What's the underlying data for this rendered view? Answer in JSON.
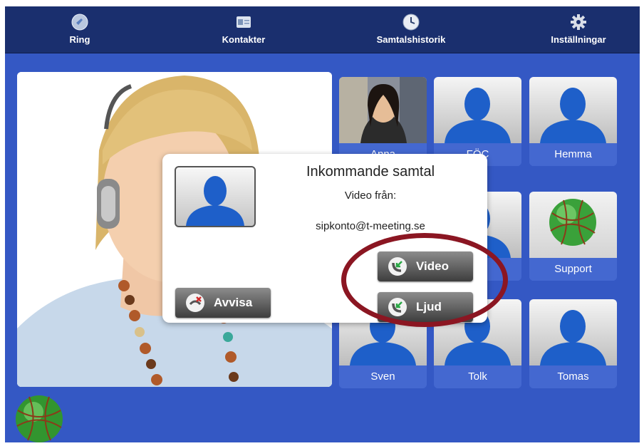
{
  "topbar": {
    "items": [
      {
        "label": "Ring",
        "icon": "call-icon"
      },
      {
        "label": "Kontakter",
        "icon": "contacts-card-icon"
      },
      {
        "label": "Samtalshistorik",
        "icon": "clock-icon"
      },
      {
        "label": "Inställningar",
        "icon": "gear-icon"
      }
    ]
  },
  "contacts": [
    {
      "name": "Anna",
      "photo": "anna-photo"
    },
    {
      "name": "FÖC",
      "photo": "default-avatar"
    },
    {
      "name": "Hemma",
      "photo": "default-avatar"
    },
    {
      "name": "",
      "photo": "default-avatar"
    },
    {
      "name": "",
      "photo": "default-avatar"
    },
    {
      "name": "Support",
      "photo": "support-globe-icon"
    },
    {
      "name": "Sven",
      "photo": "default-avatar"
    },
    {
      "name": "Tolk",
      "photo": "default-avatar"
    },
    {
      "name": "Tomas",
      "photo": "default-avatar"
    }
  ],
  "incoming_call": {
    "title": "Inkommande samtal",
    "subtitle": "Video från:",
    "address": "sipkonto@t-meeting.se",
    "decline_label": "Avvisa",
    "video_label": "Video",
    "audio_label": "Ljud"
  },
  "colors": {
    "background": "#3458c4",
    "topbar": "#1a2f6e",
    "highlight_ring": "#8b1622"
  }
}
